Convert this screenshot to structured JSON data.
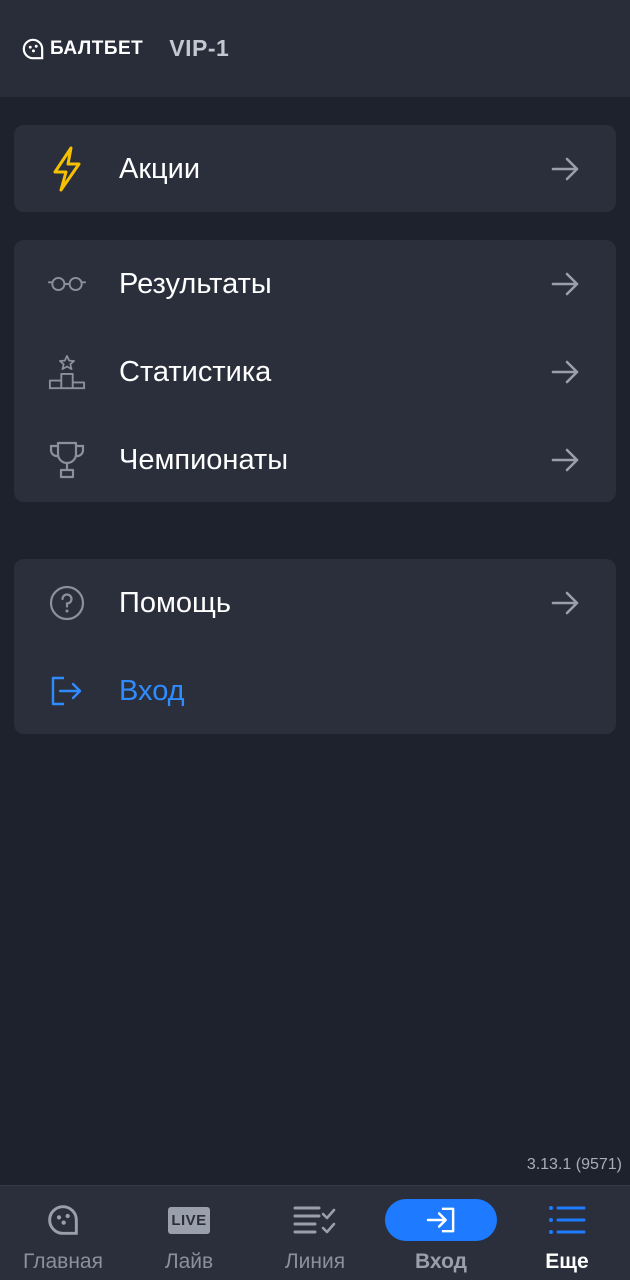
{
  "header": {
    "brand": "БАЛТБЕТ",
    "vip": "VIP-1"
  },
  "menu": {
    "promo": {
      "label": "Акции",
      "icon": "lightning-icon"
    },
    "group2": [
      {
        "label": "Результаты",
        "icon": "glasses-icon"
      },
      {
        "label": "Статистика",
        "icon": "podium-icon"
      },
      {
        "label": "Чемпионаты",
        "icon": "trophy-icon"
      }
    ],
    "group3": [
      {
        "label": "Помощь",
        "icon": "help-icon"
      },
      {
        "label": "Вход",
        "icon": "login-icon"
      }
    ]
  },
  "version": "3.13.1 (9571)",
  "bottom_nav": [
    {
      "label": "Главная",
      "icon": "home-icon"
    },
    {
      "label": "Лайв",
      "icon": "live-icon",
      "badge": "LIVE"
    },
    {
      "label": "Линия",
      "icon": "line-icon"
    },
    {
      "label": "Вход",
      "icon": "login-icon"
    },
    {
      "label": "Еще",
      "icon": "more-list-icon",
      "active": true
    }
  ],
  "colors": {
    "background": "#1e222d",
    "card": "#2a2f3b",
    "accent_blue": "#2f8cff",
    "lightning": "#f5c000",
    "muted_icon": "#8a909c"
  }
}
